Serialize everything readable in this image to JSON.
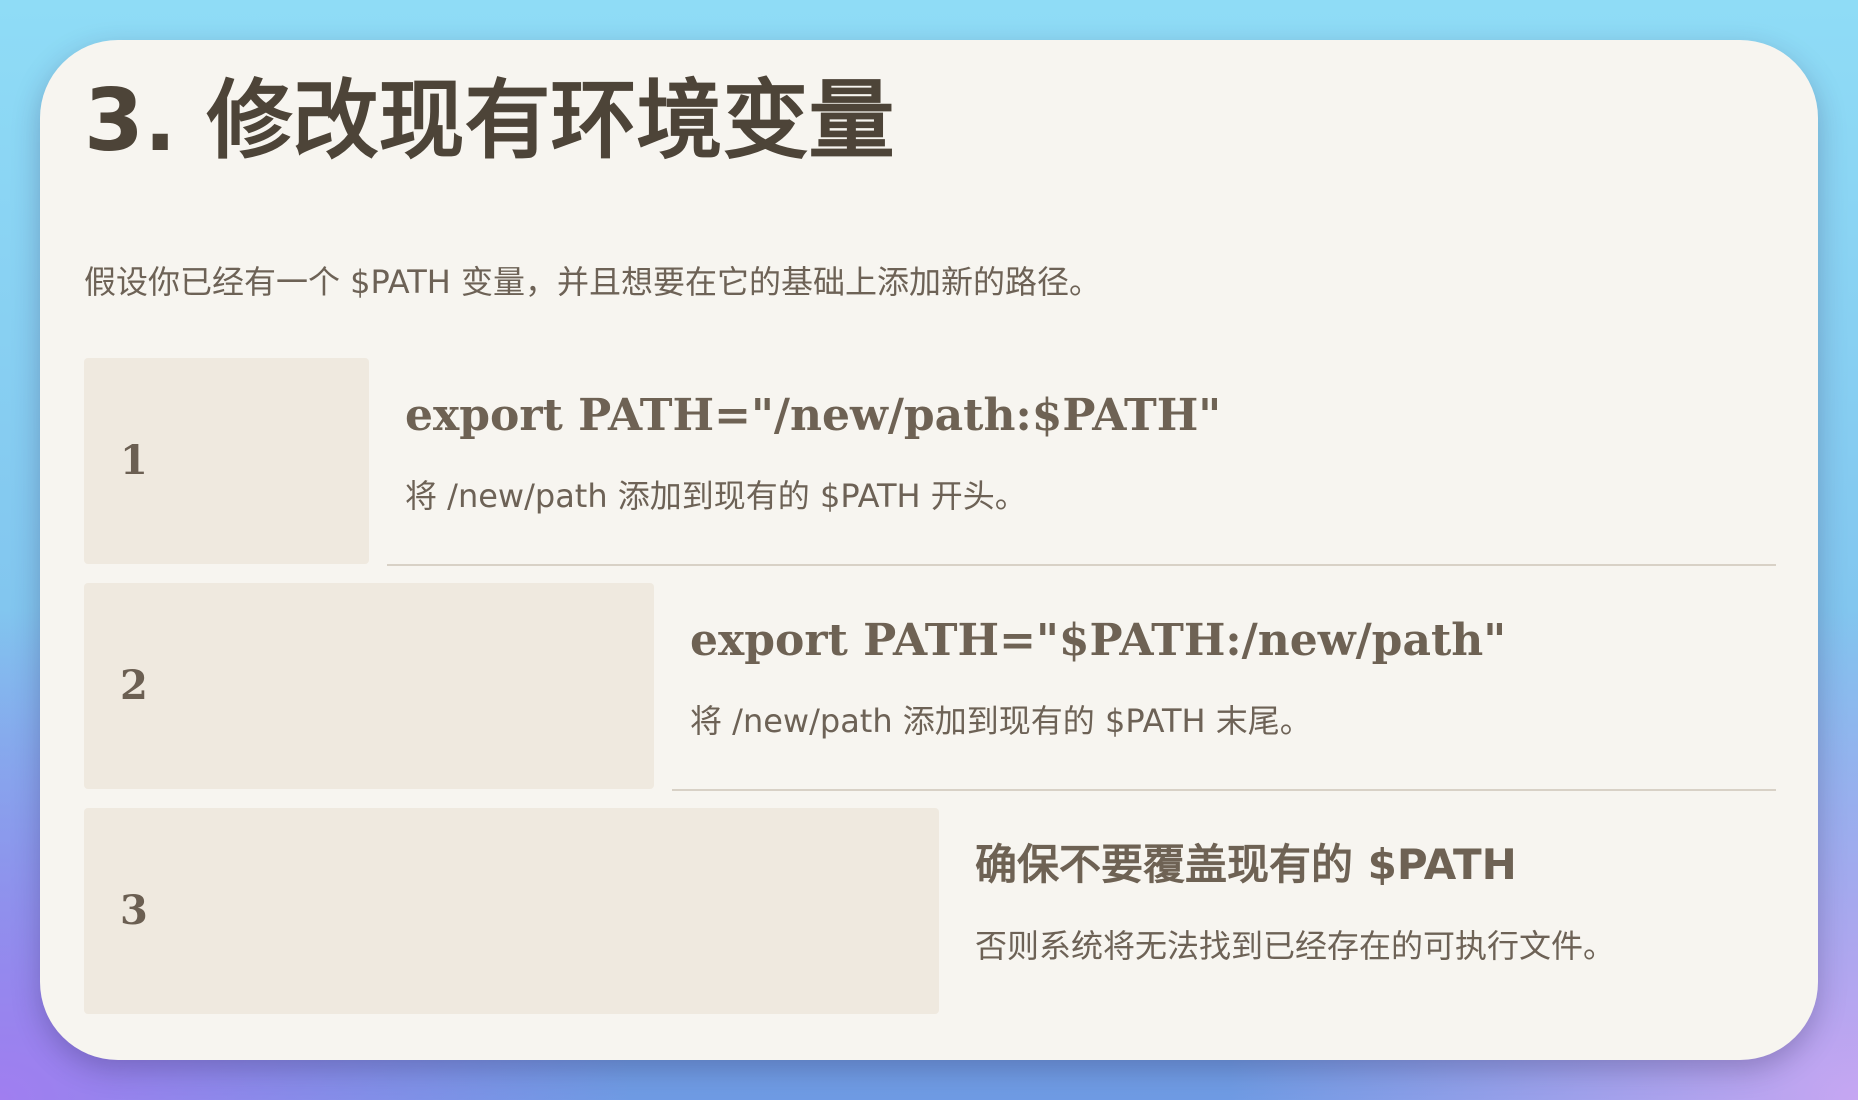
{
  "title": "3. 修改现有环境变量",
  "intro": "假设你已经有一个 $PATH 变量，并且想要在它的基础上添加新的路径。",
  "steps": [
    {
      "number": "1",
      "heading": "export PATH=\"/new/path:$PATH\"",
      "description": "将 /new/path 添加到现有的 $PATH 开头。"
    },
    {
      "number": "2",
      "heading": "export PATH=\"$PATH:/new/path\"",
      "description": "将 /new/path 添加到现有的 $PATH 末尾。"
    },
    {
      "number": "3",
      "heading": "确保不要覆盖现有的 $PATH",
      "description": "否则系统将无法找到已经存在的可执行文件。"
    }
  ],
  "colors": {
    "card_background": "#f7f5f0",
    "number_box": "#efe9df",
    "title_text": "#4d4438",
    "body_text": "#6d6256"
  }
}
